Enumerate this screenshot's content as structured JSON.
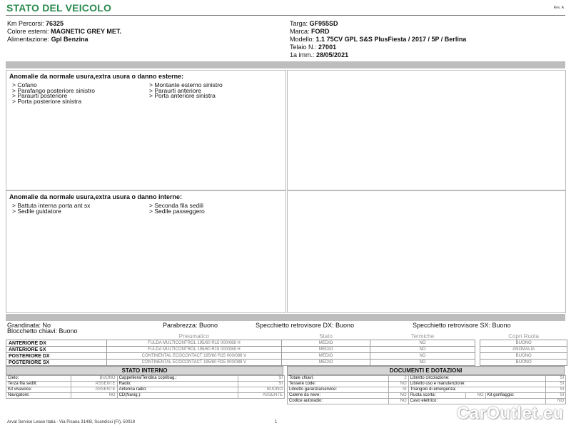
{
  "header": {
    "title": "STATO DEL VEICOLO",
    "rev": "Rev. A"
  },
  "left_fields": [
    {
      "label": "Km Percorsi:",
      "value": "76325"
    },
    {
      "label": "Colore esterni:",
      "value": "MAGNETIC GREY MET."
    },
    {
      "label": "Alimentazione:",
      "value": "Gpl Benzina"
    }
  ],
  "right_fields": [
    {
      "label": "Targa:",
      "value": "GF955SD"
    },
    {
      "label": "Marca:",
      "value": "FORD"
    },
    {
      "label": "Modello:",
      "value": "1.1 75CV GPL S&S PlusFiesta / 2017 / 5P / Berlina"
    },
    {
      "label": "Telaio N.:",
      "value": "27001"
    },
    {
      "label": "1a imm.:",
      "value": "28/05/2021"
    }
  ],
  "damage_external": {
    "title": "Anomalie da normale usura,extra usura o danno esterne:",
    "col1": [
      "> Cofano",
      "> Parafango posteriore sinistro",
      "> Paraurti posteriore",
      "> Porta posteriore sinistra"
    ],
    "col2": [
      "> Montante esterno sinistro",
      "> Paraurti anteriore",
      "> Porta anteriore sinistra"
    ]
  },
  "damage_internal": {
    "title": "Anomalie da normale usura,extra usura o danno interne:",
    "col1": [
      "> Battuta interna porta ant sx",
      "> Sedile guidatore"
    ],
    "col2": [
      "> Seconda fila sedili",
      "> Sedile passeggero"
    ]
  },
  "conditions": {
    "grandinata": "Grandinata: No",
    "parabrezza": "Parabrezza: Buono",
    "specchietto_dx": "Specchietto retrovisore DX: Buono",
    "specchietto_sx": "Specchietto retrovisore SX: Buono",
    "blocchetto": "Blocchetto chiavi: Buono"
  },
  "tyres": {
    "headers": {
      "pneumatico": "Pneumatico",
      "stato": "Stato",
      "termiche": "Termiche",
      "copri_ruota": "Copri Ruota"
    },
    "rows": [
      {
        "pos": "ANTERIORE DX",
        "model": "FULDA MULTICONTROL 195/60 R15 000/088 H",
        "stato": "MEDIO",
        "termiche": "NO",
        "copri": "BUONO"
      },
      {
        "pos": "ANTERIORE SX",
        "model": "FULDA MULTICONTROL 195/60 R15 000/088 H",
        "stato": "MEDIO",
        "termiche": "NO",
        "copri": "ANOMALIA"
      },
      {
        "pos": "POSTERIORE DX",
        "model": "CONTINENTAL ECOCONTACT 195/60 R15 000/088 V",
        "stato": "MEDIO",
        "termiche": "NO",
        "copri": "BUONO"
      },
      {
        "pos": "POSTERIORE SX",
        "model": "CONTINENTAL ECOCONTACT 195/60 R15 000/088 V",
        "stato": "MEDIO",
        "termiche": "NO",
        "copri": "BUONO"
      }
    ]
  },
  "stato_interno": {
    "title": "STATO INTERNO",
    "rows": [
      [
        {
          "l": "Cielo:",
          "v": "BUONO"
        },
        {
          "l": "Cappelliera/Tendina copribag.:",
          "v": "SI"
        }
      ],
      [
        {
          "l": "Terza fila sedili:",
          "v": "ASSENTE"
        },
        {
          "l": "Radio:",
          "v": "SI"
        }
      ],
      [
        {
          "l": "Kit vivavoce:",
          "v": "ASSENTE"
        },
        {
          "l": "Antenna radio:",
          "v": "BUONO"
        }
      ],
      [
        {
          "l": "Navigatore:",
          "v": "NO"
        },
        {
          "l": "CD(Navig.):",
          "v": "ASSENTE"
        }
      ]
    ]
  },
  "documenti": {
    "title": "DOCUMENTI E DOTAZIONI",
    "rows": [
      {
        "a": {
          "l": "Totale chiavi:",
          "v": "2"
        },
        "b": {
          "l": "Libretto circolazione:",
          "v": "SI"
        }
      },
      {
        "a": {
          "l": "Tessere code:",
          "v": "NO"
        },
        "b": {
          "l": "Libretto uso e manutenzione:",
          "v": "SI"
        }
      },
      {
        "a": {
          "l": "Libretto garanzia/service:",
          "v": "SI"
        },
        "b": {
          "l": "Triangolo di emergenza:",
          "v": "SI"
        }
      },
      {
        "a": {
          "l": "Catene da neve:",
          "v": "NO"
        },
        "b": {
          "l": "Ruota scorta:",
          "v": "NO"
        },
        "c": {
          "l": "Kit gonfiaggio:",
          "v": "SI"
        }
      },
      {
        "a": {
          "l": "Codice autoradio:",
          "v": "NO"
        },
        "b": {
          "l": "Cavo elettrico:",
          "v": "NO"
        }
      }
    ]
  },
  "footer": {
    "company": "Arval Service Lease Italia - Via Pisana 314/B, Scandicci (FI), 50018",
    "page": "1",
    "watermark": "CarOutlet.eu"
  }
}
